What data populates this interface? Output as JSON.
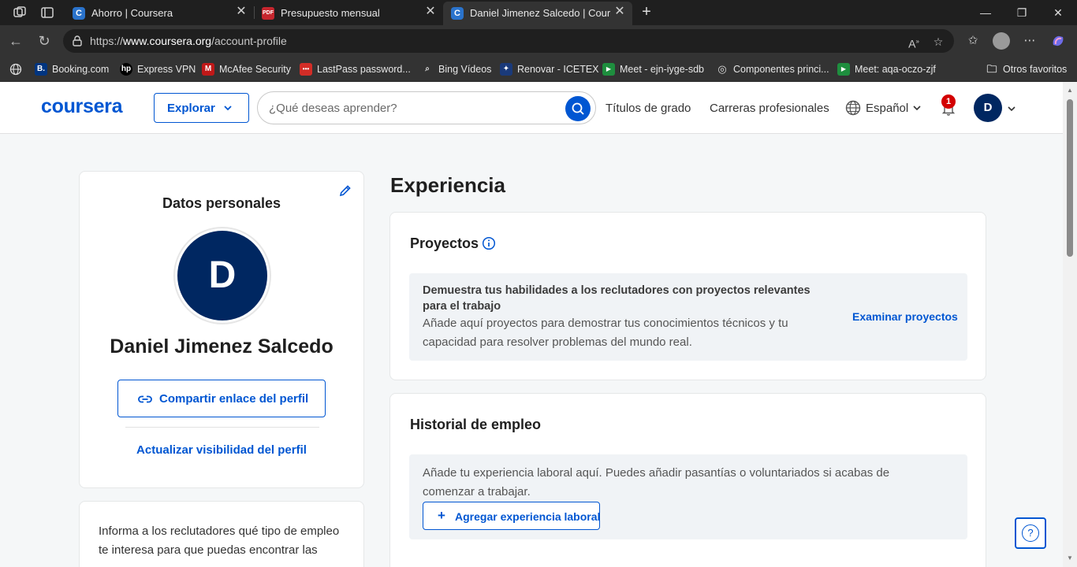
{
  "browser": {
    "tabs": [
      {
        "title": "Ahorro | Coursera",
        "favicon": "coursera-icon"
      },
      {
        "title": "Presupuesto mensual",
        "favicon": "pdf-icon"
      },
      {
        "title": "Daniel Jimenez Salcedo | Coursera",
        "favicon": "coursera-icon"
      }
    ],
    "url_prefix": "https://",
    "url_host": "www.coursera.org",
    "url_path": "/account-profile",
    "bookmarks": [
      {
        "label": "Booking.com",
        "icon_text": "B.",
        "color": "#003580"
      },
      {
        "label": "Express VPN",
        "icon_text": "hp",
        "color": "#000000"
      },
      {
        "label": "McAfee Security",
        "icon_text": "M",
        "color": "#c01818"
      },
      {
        "label": "LastPass password...",
        "icon_text": "•••",
        "color": "#d32d27"
      },
      {
        "label": "Bing Videos",
        "icon_text": "▶",
        "color": "#2b579a"
      },
      {
        "label": "Renovar - ICETEX",
        "icon_text": "✦",
        "color": "#1a3a7a"
      },
      {
        "label": "Meet - ejn-iyge-sdb",
        "icon_text": "▶",
        "color": "#1e8e3e"
      },
      {
        "label": "Componentes princi...",
        "icon_text": "◎",
        "color": "#444444"
      },
      {
        "label": "Meet: aqa-oczo-zjf",
        "icon_text": "▶",
        "color": "#1e8e3e"
      }
    ],
    "other_favorites": "Otros favoritos"
  },
  "header": {
    "logo": "coursera",
    "explore_label": "Explorar",
    "search_placeholder": "¿Qué deseas aprender?",
    "degrees_link": "Títulos de grado",
    "careers_link": "Carreras profesionales",
    "language": "Español",
    "notification_count": "1",
    "user_initial": "D"
  },
  "profile": {
    "section_title": "Datos personales",
    "avatar_initial": "D",
    "name": "Daniel Jimenez Salcedo",
    "share_label": "Compartir enlace del perfil",
    "visibility_label": "Actualizar visibilidad del perfil",
    "info_text": "Informa a los reclutadores qué tipo de empleo te interesa para que puedas encontrar las"
  },
  "experience": {
    "title": "Experiencia",
    "projects": {
      "heading": "Proyectos",
      "panel_title": "Demuestra tus habilidades a los reclutadores con proyectos relevantes para el trabajo",
      "panel_text": "Añade aquí proyectos para demostrar tus conocimientos técnicos y tu capacidad para resolver problemas del mundo real.",
      "link": "Examinar proyectos"
    },
    "employment": {
      "heading": "Historial de empleo",
      "panel_text": "Añade tu experiencia laboral aquí. Puedes añadir pasantías o voluntariados si acabas de comenzar a trabajar.",
      "button": "Agregar experiencia laboral"
    }
  },
  "help_button": "?",
  "colors": {
    "brand": "#0056d2",
    "avatar": "#002761",
    "badge": "#d30001"
  }
}
